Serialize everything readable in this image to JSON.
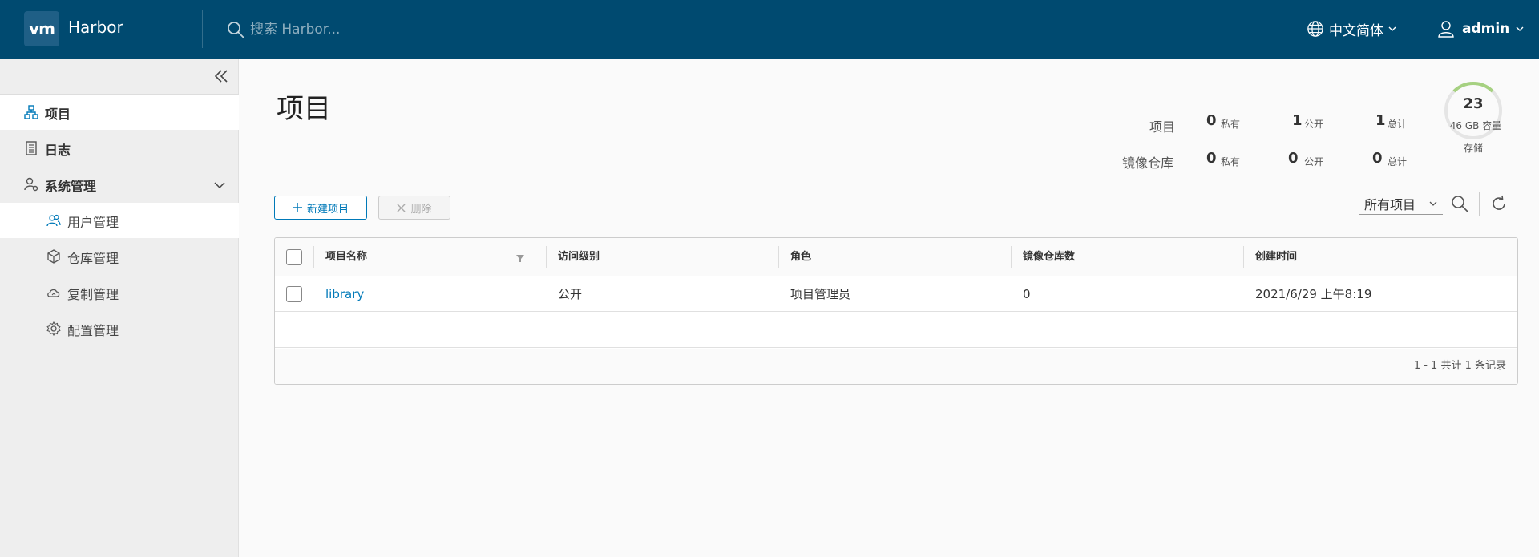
{
  "header": {
    "logo_text": "vm",
    "brand": "Harbor",
    "search_placeholder": "搜索 Harbor...",
    "language": "中文简体",
    "user": "admin"
  },
  "sidebar": {
    "items": [
      {
        "label": "项目",
        "icon": "projects-icon",
        "active": true
      },
      {
        "label": "日志",
        "icon": "log-icon",
        "active": false
      },
      {
        "label": "系统管理",
        "icon": "user-gear-icon",
        "active": false,
        "expanded": true
      }
    ],
    "sub_items": [
      {
        "label": "用户管理",
        "icon": "users-icon",
        "active": true
      },
      {
        "label": "仓库管理",
        "icon": "cube-icon",
        "active": false
      },
      {
        "label": "复制管理",
        "icon": "cloud-icon",
        "active": false
      },
      {
        "label": "配置管理",
        "icon": "gear-icon",
        "active": false
      }
    ]
  },
  "main": {
    "title": "项目",
    "stats": {
      "projects_label": "项目",
      "repos_label": "镜像仓库",
      "projects": {
        "private": "0",
        "public": "1",
        "total": "1"
      },
      "repos": {
        "private": "0",
        "public": "0",
        "total": "0"
      },
      "private_label": "私有",
      "public_label": "公开",
      "total_label": "总计"
    },
    "storage": {
      "count": "23",
      "capacity": "46 GB 容量",
      "label": "存储",
      "used_fraction": 0.5,
      "color": "#a6d181"
    },
    "toolbar": {
      "new_label": "新建项目",
      "delete_label": "删除",
      "filter_value": "所有项目"
    },
    "table": {
      "columns": [
        "项目名称",
        "访问级别",
        "角色",
        "镜像仓库数",
        "创建时间"
      ],
      "rows": [
        {
          "name": "library",
          "access": "公开",
          "role": "项目管理员",
          "repos": "0",
          "created": "2021/6/29 上午8:19"
        }
      ],
      "footer": "1 - 1 共计 1 条记录"
    }
  },
  "colors": {
    "header_bg": "#004a70",
    "accent": "#0079b8"
  }
}
